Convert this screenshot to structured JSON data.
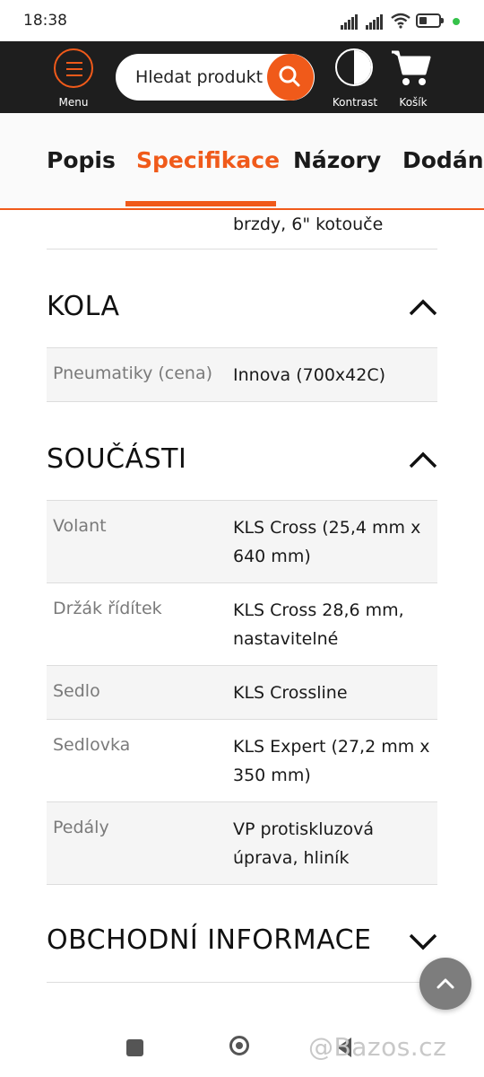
{
  "status_bar": {
    "time": "18:38"
  },
  "header": {
    "menu_label": "Menu",
    "search_placeholder": "Hledat produkt",
    "kontrast_label": "Kontrast",
    "cart_label": "Košík",
    "accent_color": "#f05a1a"
  },
  "tabs": [
    {
      "label": "Popis"
    },
    {
      "label": "Specifikace",
      "active": true
    },
    {
      "label": "Názory"
    },
    {
      "label": "Dodání"
    }
  ],
  "partial_row": {
    "value": "brzdy, 6\" kotouče"
  },
  "sections": [
    {
      "title": "KOLA",
      "expanded": true,
      "rows": [
        {
          "label": "Pneumatiky (cena)",
          "value": "Innova (700x42C)"
        }
      ]
    },
    {
      "title": "SOUČÁSTI",
      "expanded": true,
      "rows": [
        {
          "label": "Volant",
          "value": "KLS Cross (25,4 mm x 640 mm)"
        },
        {
          "label": "Držák řídítek",
          "value": "KLS Cross 28,6 mm, nastavitelné"
        },
        {
          "label": "Sedlo",
          "value": "KLS Crossline"
        },
        {
          "label": "Sedlovka",
          "value": "KLS Expert (27,2 mm x 350 mm)"
        },
        {
          "label": "Pedály",
          "value": "VP protiskluzová úprava, hliník"
        }
      ]
    },
    {
      "title": "OBCHODNÍ INFORMACE",
      "expanded": false,
      "rows": []
    }
  ],
  "watermark": "@Bazos.cz"
}
